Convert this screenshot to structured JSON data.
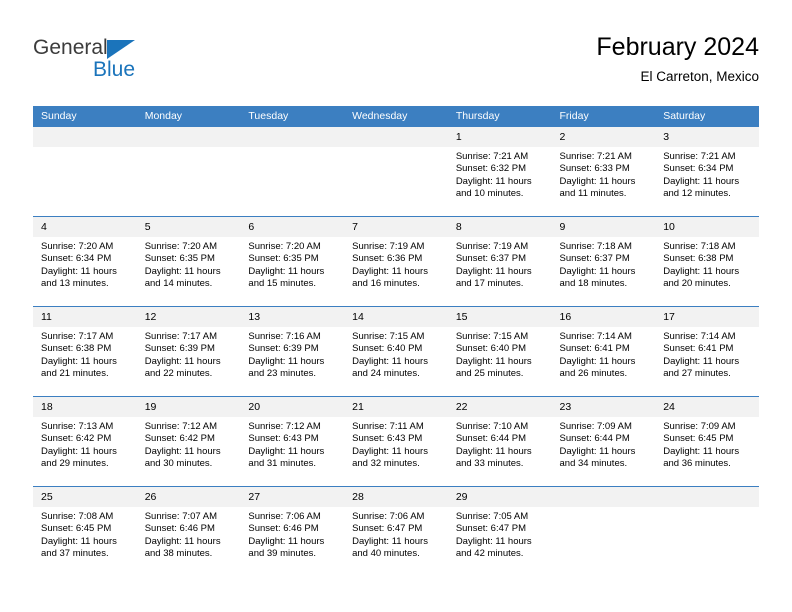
{
  "brand": {
    "name_part1": "General",
    "name_part2": "Blue",
    "triangle_icon": "triangle-icon",
    "accent_color": "#1b74bb"
  },
  "header": {
    "title": "February 2024",
    "subtitle": "El Carreton, Mexico"
  },
  "calendar": {
    "header_bg": "#3c7fc1",
    "daynum_bg": "#f2f2f2",
    "weekday_headers": [
      "Sunday",
      "Monday",
      "Tuesday",
      "Wednesday",
      "Thursday",
      "Friday",
      "Saturday"
    ],
    "weeks": [
      [
        {
          "day": "",
          "blank": true
        },
        {
          "day": "",
          "blank": true
        },
        {
          "day": "",
          "blank": true
        },
        {
          "day": "",
          "blank": true
        },
        {
          "day": "1",
          "sunrise": "Sunrise: 7:21 AM",
          "sunset": "Sunset: 6:32 PM",
          "daylight": "Daylight: 11 hours and 10 minutes."
        },
        {
          "day": "2",
          "sunrise": "Sunrise: 7:21 AM",
          "sunset": "Sunset: 6:33 PM",
          "daylight": "Daylight: 11 hours and 11 minutes."
        },
        {
          "day": "3",
          "sunrise": "Sunrise: 7:21 AM",
          "sunset": "Sunset: 6:34 PM",
          "daylight": "Daylight: 11 hours and 12 minutes."
        }
      ],
      [
        {
          "day": "4",
          "sunrise": "Sunrise: 7:20 AM",
          "sunset": "Sunset: 6:34 PM",
          "daylight": "Daylight: 11 hours and 13 minutes."
        },
        {
          "day": "5",
          "sunrise": "Sunrise: 7:20 AM",
          "sunset": "Sunset: 6:35 PM",
          "daylight": "Daylight: 11 hours and 14 minutes."
        },
        {
          "day": "6",
          "sunrise": "Sunrise: 7:20 AM",
          "sunset": "Sunset: 6:35 PM",
          "daylight": "Daylight: 11 hours and 15 minutes."
        },
        {
          "day": "7",
          "sunrise": "Sunrise: 7:19 AM",
          "sunset": "Sunset: 6:36 PM",
          "daylight": "Daylight: 11 hours and 16 minutes."
        },
        {
          "day": "8",
          "sunrise": "Sunrise: 7:19 AM",
          "sunset": "Sunset: 6:37 PM",
          "daylight": "Daylight: 11 hours and 17 minutes."
        },
        {
          "day": "9",
          "sunrise": "Sunrise: 7:18 AM",
          "sunset": "Sunset: 6:37 PM",
          "daylight": "Daylight: 11 hours and 18 minutes."
        },
        {
          "day": "10",
          "sunrise": "Sunrise: 7:18 AM",
          "sunset": "Sunset: 6:38 PM",
          "daylight": "Daylight: 11 hours and 20 minutes."
        }
      ],
      [
        {
          "day": "11",
          "sunrise": "Sunrise: 7:17 AM",
          "sunset": "Sunset: 6:38 PM",
          "daylight": "Daylight: 11 hours and 21 minutes."
        },
        {
          "day": "12",
          "sunrise": "Sunrise: 7:17 AM",
          "sunset": "Sunset: 6:39 PM",
          "daylight": "Daylight: 11 hours and 22 minutes."
        },
        {
          "day": "13",
          "sunrise": "Sunrise: 7:16 AM",
          "sunset": "Sunset: 6:39 PM",
          "daylight": "Daylight: 11 hours and 23 minutes."
        },
        {
          "day": "14",
          "sunrise": "Sunrise: 7:15 AM",
          "sunset": "Sunset: 6:40 PM",
          "daylight": "Daylight: 11 hours and 24 minutes."
        },
        {
          "day": "15",
          "sunrise": "Sunrise: 7:15 AM",
          "sunset": "Sunset: 6:40 PM",
          "daylight": "Daylight: 11 hours and 25 minutes."
        },
        {
          "day": "16",
          "sunrise": "Sunrise: 7:14 AM",
          "sunset": "Sunset: 6:41 PM",
          "daylight": "Daylight: 11 hours and 26 minutes."
        },
        {
          "day": "17",
          "sunrise": "Sunrise: 7:14 AM",
          "sunset": "Sunset: 6:41 PM",
          "daylight": "Daylight: 11 hours and 27 minutes."
        }
      ],
      [
        {
          "day": "18",
          "sunrise": "Sunrise: 7:13 AM",
          "sunset": "Sunset: 6:42 PM",
          "daylight": "Daylight: 11 hours and 29 minutes."
        },
        {
          "day": "19",
          "sunrise": "Sunrise: 7:12 AM",
          "sunset": "Sunset: 6:42 PM",
          "daylight": "Daylight: 11 hours and 30 minutes."
        },
        {
          "day": "20",
          "sunrise": "Sunrise: 7:12 AM",
          "sunset": "Sunset: 6:43 PM",
          "daylight": "Daylight: 11 hours and 31 minutes."
        },
        {
          "day": "21",
          "sunrise": "Sunrise: 7:11 AM",
          "sunset": "Sunset: 6:43 PM",
          "daylight": "Daylight: 11 hours and 32 minutes."
        },
        {
          "day": "22",
          "sunrise": "Sunrise: 7:10 AM",
          "sunset": "Sunset: 6:44 PM",
          "daylight": "Daylight: 11 hours and 33 minutes."
        },
        {
          "day": "23",
          "sunrise": "Sunrise: 7:09 AM",
          "sunset": "Sunset: 6:44 PM",
          "daylight": "Daylight: 11 hours and 34 minutes."
        },
        {
          "day": "24",
          "sunrise": "Sunrise: 7:09 AM",
          "sunset": "Sunset: 6:45 PM",
          "daylight": "Daylight: 11 hours and 36 minutes."
        }
      ],
      [
        {
          "day": "25",
          "sunrise": "Sunrise: 7:08 AM",
          "sunset": "Sunset: 6:45 PM",
          "daylight": "Daylight: 11 hours and 37 minutes."
        },
        {
          "day": "26",
          "sunrise": "Sunrise: 7:07 AM",
          "sunset": "Sunset: 6:46 PM",
          "daylight": "Daylight: 11 hours and 38 minutes."
        },
        {
          "day": "27",
          "sunrise": "Sunrise: 7:06 AM",
          "sunset": "Sunset: 6:46 PM",
          "daylight": "Daylight: 11 hours and 39 minutes."
        },
        {
          "day": "28",
          "sunrise": "Sunrise: 7:06 AM",
          "sunset": "Sunset: 6:47 PM",
          "daylight": "Daylight: 11 hours and 40 minutes."
        },
        {
          "day": "29",
          "sunrise": "Sunrise: 7:05 AM",
          "sunset": "Sunset: 6:47 PM",
          "daylight": "Daylight: 11 hours and 42 minutes."
        },
        {
          "day": "",
          "blank": true
        },
        {
          "day": "",
          "blank": true
        }
      ]
    ]
  }
}
